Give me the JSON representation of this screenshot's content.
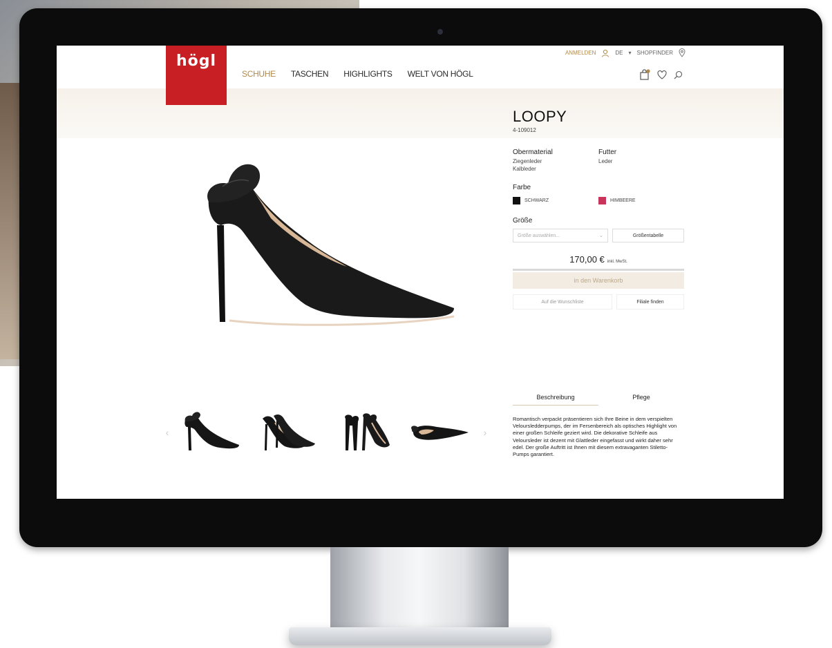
{
  "colors": {
    "brand": "#c81f25",
    "accent": "#b08a4a",
    "cart_bg": "#f3ece3",
    "swatch_black": "#111111",
    "swatch_raspberry": "#c8345a"
  },
  "header": {
    "logo": "högl",
    "nav": [
      "SCHUHE",
      "TASCHEN",
      "HIGHLIGHTS",
      "WELT VON HÖGL"
    ],
    "login": "ANMELDEN",
    "language": "DE",
    "shopfinder": "SHOPFINDER"
  },
  "product": {
    "name": "LOOPY",
    "sku": "4-109012",
    "material_label": "Obermaterial",
    "material_values": [
      "Ziegenleder",
      "Kalbleder"
    ],
    "lining_label": "Futter",
    "lining_value": "Leder",
    "color_label": "Farbe",
    "color_options": [
      "SCHWARZ",
      "HIMBEERE"
    ],
    "size_label": "Größe",
    "size_placeholder": "Größe auswählen...",
    "size_table": "Größentabelle",
    "price": "170,00 €",
    "vat": "inkl. MwSt.",
    "add_to_cart": "in den Warenkorb",
    "wishlist": "Auf die Wunschliste",
    "find_store": "Filiale finden"
  },
  "tabs": [
    "Beschreibung",
    "Pflege"
  ],
  "description": "Romantisch verpackt präsentieren sich Ihre Beine in dem verspielten Veloursledderpumps, der im Fersenbereich als optisches Highlight von einer großen Schleife geziert wird. Die dekorative Schleife aus Veloursleder ist dezent mit Glattleder eingefasst und wirkt daher sehr edel. Der große Auftritt ist Ihnen mit diesem extravaganten Stiletto-Pumps garantiert.",
  "gallery": {
    "thumbnails": [
      "shoe-side-thumb",
      "shoe-pair-thumb",
      "shoe-back-thumb",
      "shoe-top-thumb"
    ],
    "prev_icon": "chevron-left-icon",
    "next_icon": "chevron-right-icon"
  }
}
